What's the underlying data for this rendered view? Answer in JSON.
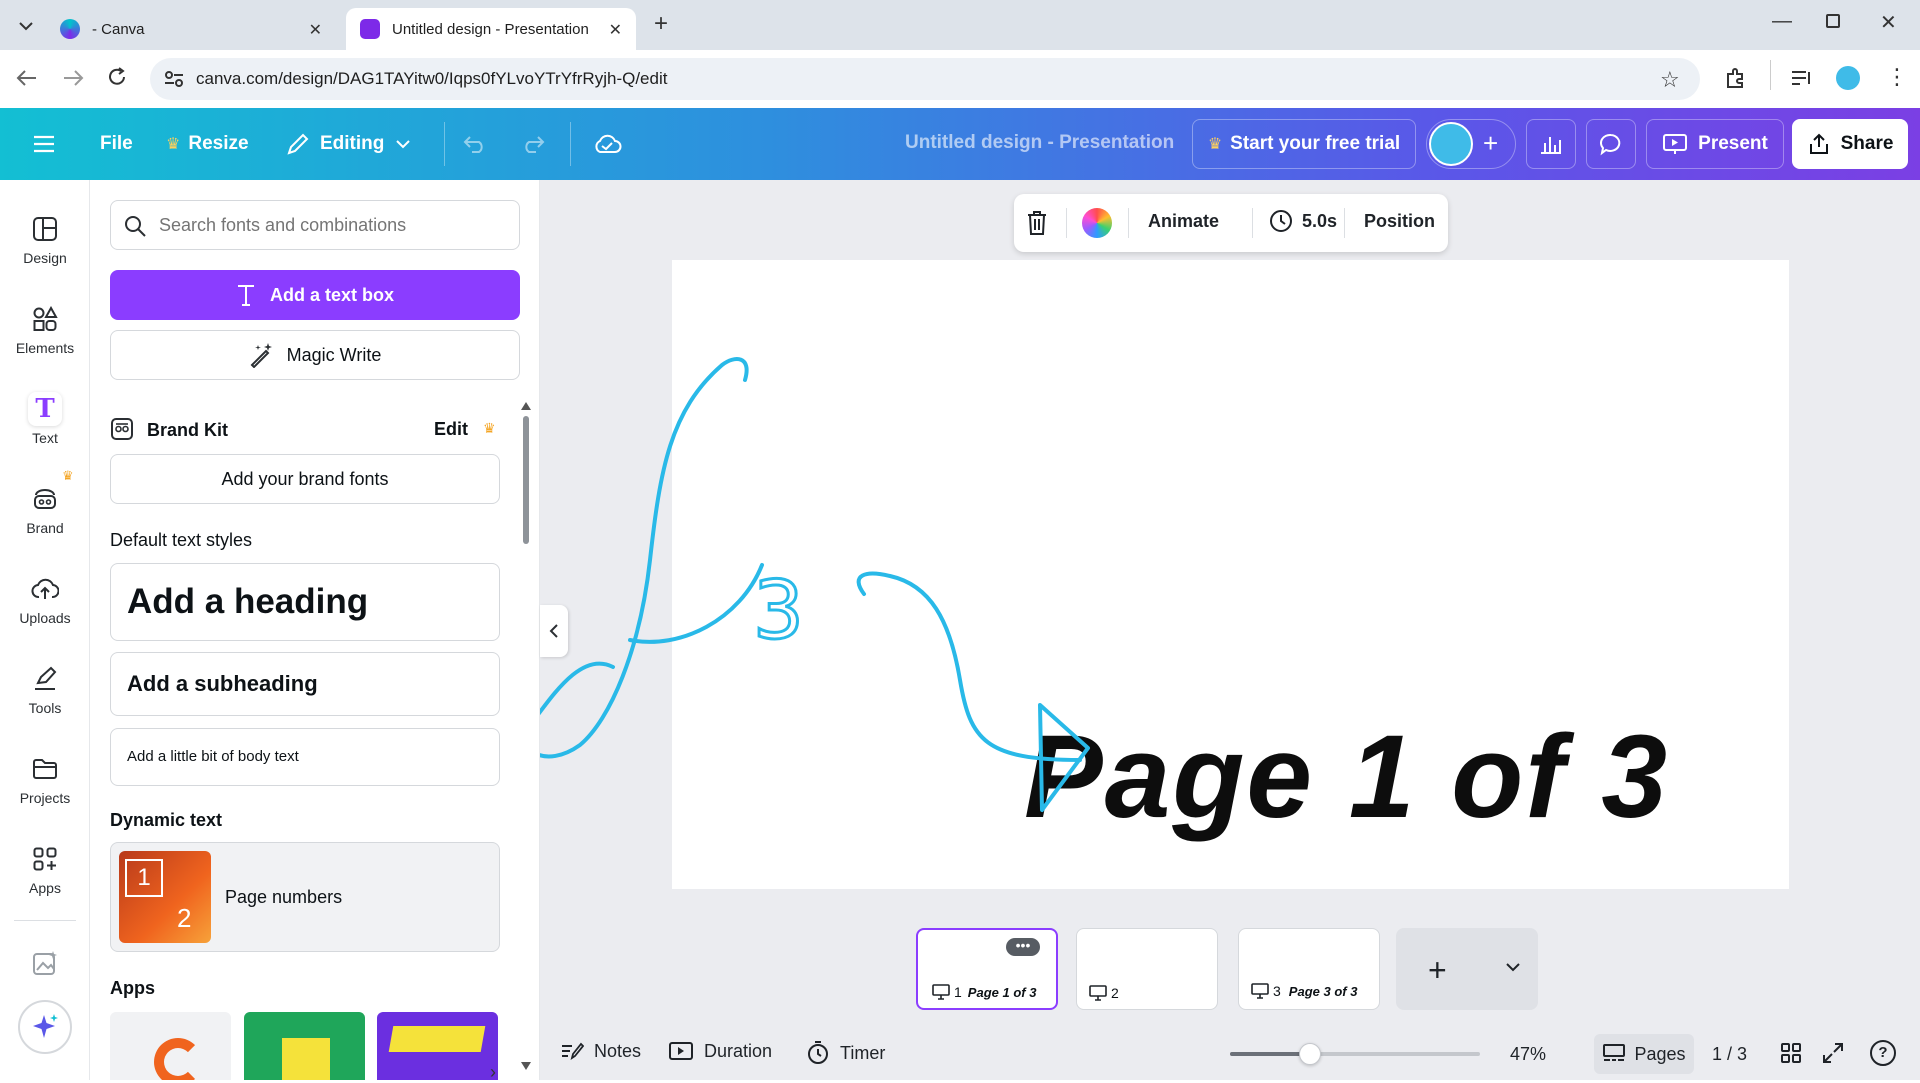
{
  "browser": {
    "tabs": [
      {
        "title": "- Canva",
        "active": false
      },
      {
        "title": "Untitled design - Presentation",
        "active": true
      }
    ],
    "url": "canva.com/design/DAG1TAYitw0/Iqps0fYLvoYTrYfrRyjh-Q/edit"
  },
  "header": {
    "file": "File",
    "resize": "Resize",
    "editing": "Editing",
    "title": "Untitled design - Presentation",
    "trial": "Start your free trial",
    "present": "Present",
    "share": "Share"
  },
  "rail": {
    "items": [
      {
        "label": "Design",
        "icon": "layout-icon"
      },
      {
        "label": "Elements",
        "icon": "shapes-icon"
      },
      {
        "label": "Text",
        "icon": "text-icon"
      },
      {
        "label": "Brand",
        "icon": "brand-icon"
      },
      {
        "label": "Uploads",
        "icon": "cloud-upload-icon"
      },
      {
        "label": "Tools",
        "icon": "pen-icon"
      },
      {
        "label": "Projects",
        "icon": "folder-icon"
      },
      {
        "label": "Apps",
        "icon": "apps-icon"
      }
    ]
  },
  "panel": {
    "search_placeholder": "Search fonts and combinations",
    "add_text_box": "Add a text box",
    "magic_write": "Magic Write",
    "brand_kit": "Brand Kit",
    "brand_edit": "Edit",
    "add_brand_fonts": "Add your brand fonts",
    "default_styles": "Default text styles",
    "heading": "Add a heading",
    "subheading": "Add a subheading",
    "body": "Add a little bit of body text",
    "dynamic_text": "Dynamic text",
    "page_numbers": "Page numbers",
    "page_numbers_badge_top": "1",
    "page_numbers_badge_bottom": "2",
    "apps": "Apps"
  },
  "canvas": {
    "toolbar": {
      "animate": "Animate",
      "duration": "5.0s",
      "position": "Position"
    },
    "page_text": "Page 1 of 3",
    "scribble_text": "3"
  },
  "thumbnails": [
    {
      "num": "1",
      "label": "Page 1 of 3",
      "selected": true
    },
    {
      "num": "2",
      "label": "",
      "selected": false
    },
    {
      "num": "3",
      "label": "Page 3 of 3",
      "selected": false
    }
  ],
  "footer": {
    "notes": "Notes",
    "duration": "Duration",
    "timer": "Timer",
    "zoom": "47%",
    "zoom_value": 47,
    "pages": "Pages",
    "page_count": "1 / 3"
  },
  "colors": {
    "accent": "#8b3dff",
    "scribble": "#29b9e8",
    "selected_border": "#8b3dff",
    "crown": "#f4a524"
  }
}
